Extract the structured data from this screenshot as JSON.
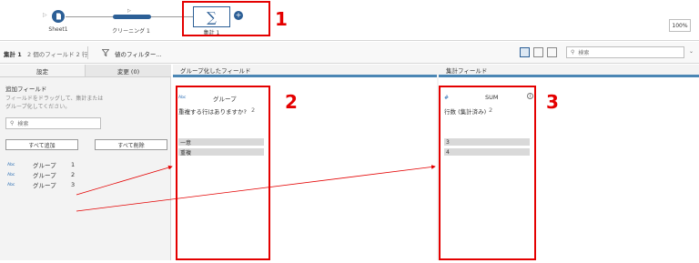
{
  "flow": {
    "nodes": [
      {
        "label": "Sheet1",
        "icon": "document-icon"
      },
      {
        "label": "クリーニング 1",
        "icon": "cleaning-bar-icon"
      },
      {
        "label": "集計 1",
        "icon": "sigma-icon"
      }
    ],
    "sigma_glyph": "∑",
    "add_glyph": "+",
    "zoom": "100%"
  },
  "toolbar": {
    "step_name": "集計 1",
    "summary": "2 個のフィールド 2 行",
    "filter_label": "値のフィルター...",
    "search_placeholder": "検索"
  },
  "left_panel": {
    "tabs": [
      "設定",
      "変更 (0)"
    ],
    "section_title": "追加フィールド",
    "hint": "フィールドをドラッグして、集計またはグループ化してください。",
    "search_placeholder": "検索",
    "add_all": "すべて追加",
    "remove_all": "すべて削除",
    "fields": [
      {
        "type": "Abc",
        "name": "グループ",
        "count": "1"
      },
      {
        "type": "Abc",
        "name": "グループ",
        "count": "2"
      },
      {
        "type": "Abc",
        "name": "グループ",
        "count": "3"
      }
    ]
  },
  "group_column": {
    "header": "グループ化したフィールド",
    "card": {
      "type": "Abc",
      "title": "グループ",
      "subtitle": "重複する行はありますか?",
      "subcount": "2",
      "values": [
        "一意",
        "重複"
      ]
    }
  },
  "agg_column": {
    "header": "集計フィールド",
    "card": {
      "type": "#",
      "title": "SUM",
      "subtitle": "行数 (集計済み)",
      "subcount": "2",
      "values": [
        "3",
        "4"
      ]
    }
  },
  "annotations": [
    "1",
    "2",
    "3"
  ],
  "colors": {
    "accent": "#2c5f96",
    "highlight": "#e40000",
    "header_stripe": "#4b86b4"
  }
}
